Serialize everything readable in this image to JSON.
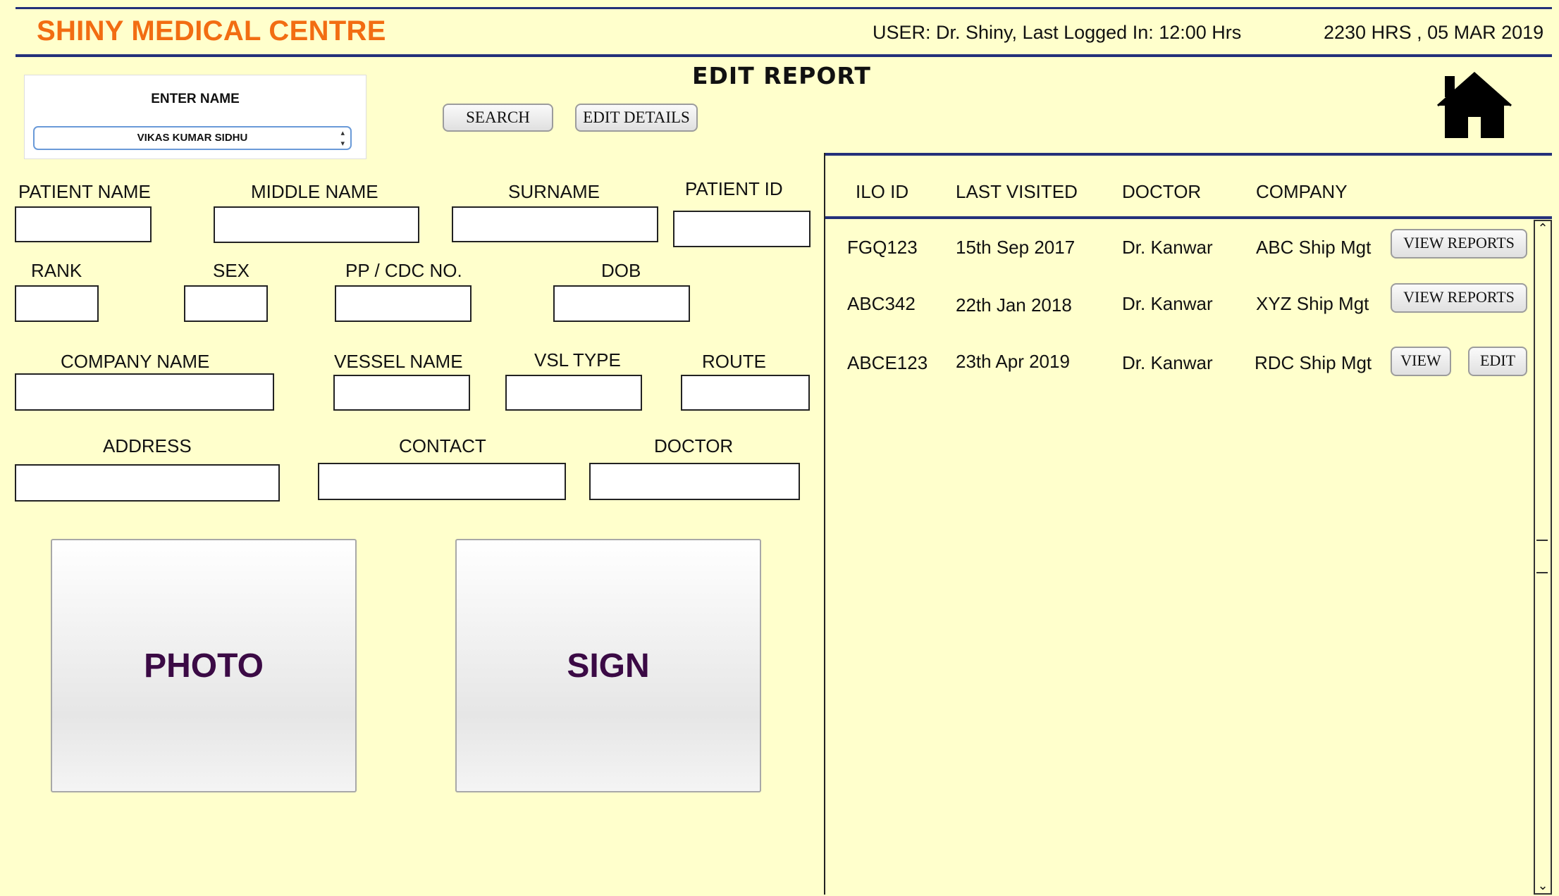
{
  "header": {
    "brand": "SHINY MEDICAL CENTRE",
    "user_info": "USER: Dr. Shiny, Last Logged In: 12:00 Hrs",
    "datetime": "2230 HRS , 05 MAR 2019",
    "page_title": "EDIT REPORT"
  },
  "search": {
    "enter_name_label": "ENTER NAME",
    "selected_name": "VIKAS KUMAR SIDHU",
    "search_label": "SEARCH",
    "edit_details_label": "EDIT DETAILS"
  },
  "form": {
    "labels": {
      "patient_name": "PATIENT NAME",
      "middle_name": "MIDDLE NAME",
      "surname": "SURNAME",
      "patient_id": "PATIENT ID",
      "rank": "RANK",
      "sex": "SEX",
      "pp_cdc": "PP / CDC NO.",
      "dob": "DOB",
      "company_name": "COMPANY NAME",
      "vessel_name": "VESSEL NAME",
      "vsl_type": "VSL TYPE",
      "route": "ROUTE",
      "address": "ADDRESS",
      "contact": "CONTACT",
      "doctor": "DOCTOR"
    },
    "photo_label": "PHOTO",
    "sign_label": "SIGN"
  },
  "table": {
    "headers": [
      "ILO ID",
      "LAST VISITED",
      "DOCTOR",
      "COMPANY"
    ],
    "rows": [
      {
        "ilo_id": "FGQ123",
        "last_visited": "15th Sep 2017",
        "doctor": "Dr. Kanwar",
        "company": "ABC Ship Mgt",
        "action": "VIEW REPORTS"
      },
      {
        "ilo_id": "ABC342",
        "last_visited": "22th Jan 2018",
        "doctor": "Dr. Kanwar",
        "company": "XYZ Ship Mgt",
        "action": "VIEW REPORTS"
      },
      {
        "ilo_id": "ABCE123",
        "last_visited": "23th Apr 2019",
        "doctor": "Dr. Kanwar",
        "company": "RDC Ship Mgt",
        "view": "VIEW",
        "edit": "EDIT"
      }
    ]
  },
  "icons": {
    "home": "home-icon"
  },
  "colors": {
    "brand": "#f26d12",
    "background": "#ffffcc",
    "rule": "#24307a",
    "tile_text": "#3b0a45"
  }
}
